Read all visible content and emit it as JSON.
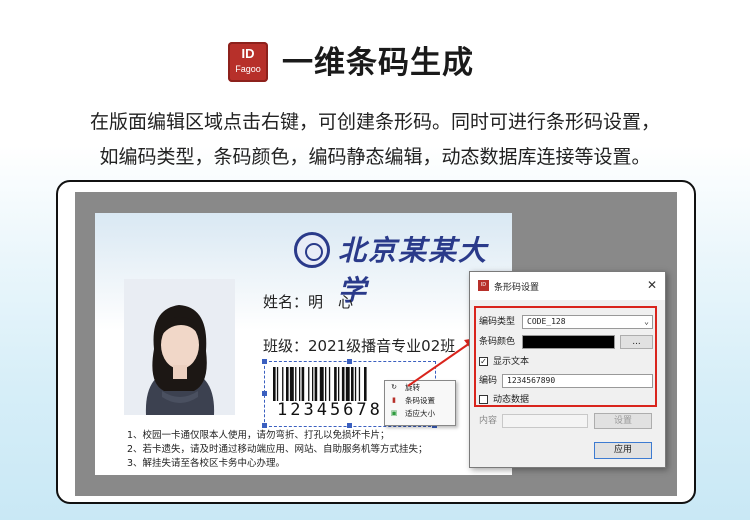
{
  "header": {
    "logo_line1": "ID",
    "logo_line2": "Fagoo",
    "title": "一维条码生成"
  },
  "description": {
    "line1": "在版面编辑区域点击右键，可创建条形码。同时可进行条形码设置，",
    "line2": "如编码类型，条码颜色，编码静态编辑，动态数据库连接等设置。"
  },
  "card": {
    "university": "北京某某大学",
    "name_line": "姓名：明　心",
    "class_line": "班级：2021级播音专业02班",
    "barcode_digits": "12345678",
    "notes": [
      "1、校园一卡通仅限本人使用，请勿弯折、打孔以免损坏卡片；",
      "2、若卡遗失，请及时通过移动端应用、网站、自助服务机等方式挂失；",
      "3、解挂失请至各校区卡务中心办理。"
    ]
  },
  "context_menu": {
    "items": [
      {
        "icon": "rotate-icon",
        "label": "旋转"
      },
      {
        "icon": "barcode-icon",
        "label": "条码设置"
      },
      {
        "icon": "fit-size-icon",
        "label": "适应大小"
      }
    ]
  },
  "dialog": {
    "title": "条形码设置",
    "close": "✕",
    "encode_type_label": "编码类型",
    "encode_type_value": "CODE_128",
    "color_label": "条码颜色",
    "color_value": "#000000",
    "color_button": "...",
    "show_text_label": "显示文本",
    "show_text_checked": true,
    "code_label": "编码",
    "code_value": "1234567890",
    "dynamic_label": "动态数据",
    "dynamic_checked": false,
    "content_label": "内容",
    "set_button": "设置",
    "apply_button": "应用"
  },
  "colors": {
    "accent": "#d9241c",
    "logo": "#b7302a",
    "university": "#2a3a8a"
  }
}
